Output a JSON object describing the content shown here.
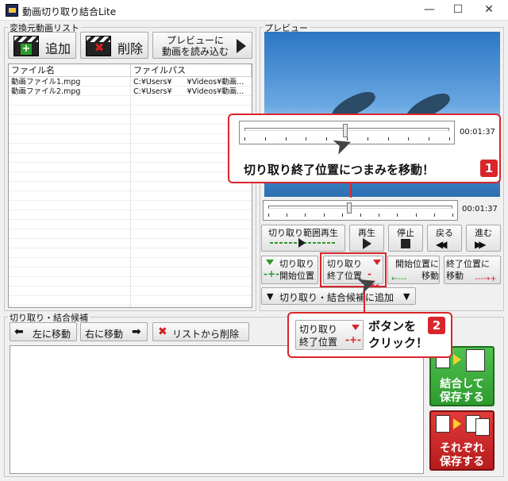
{
  "window": {
    "title": "動画切り取り結合Lite",
    "minimize": "—",
    "maximize": "☐",
    "close": "✕"
  },
  "source_list": {
    "group_label": "変換元動画リスト",
    "add_label": "追加",
    "delete_label": "削除",
    "load_preview_label": [
      "プレビューに",
      "動画を読み込む"
    ],
    "columns": [
      "ファイル名",
      "ファイルパス"
    ],
    "rows": [
      {
        "name": "動画ファイル1.mpg",
        "path": "C:¥Users¥　　¥Videos¥動画..."
      },
      {
        "name": "動画ファイル2.mpg",
        "path": "C:¥Users¥　　¥Videos¥動画..."
      }
    ]
  },
  "preview": {
    "group_label": "プレビュー",
    "time": "00:01:37",
    "position_fraction": 0.44
  },
  "controls": {
    "range_play": "切り取り範囲再生",
    "play": "再生",
    "stop": "停止",
    "back": "戻る",
    "forward": "進む",
    "cut_start": [
      "切り取り",
      "開始位置"
    ],
    "cut_end": [
      "切り取り",
      "終了位置"
    ],
    "move_to_start": [
      "開始位置に",
      "移動"
    ],
    "move_to_end": [
      "終了位置に",
      "移動"
    ],
    "add_to_candidates": "切り取り・結合候補に追加"
  },
  "candidates": {
    "group_label": "切り取り・結合候補",
    "move_left": "左に移動",
    "move_right": "右に移動",
    "remove": "リストから削除",
    "join_save": [
      "結合して",
      "保存する"
    ],
    "save_each": [
      "それぞれ",
      "保存する"
    ]
  },
  "annotations": {
    "callout1_text": "切り取り終了位置につまみを移動！",
    "callout1_num": "1",
    "callout2_button": [
      "切り取り",
      "終了位置"
    ],
    "callout2_text": [
      "ボタンを",
      "クリック！"
    ],
    "callout2_num": "2",
    "zoom_time": "00:01:37"
  },
  "colors": {
    "accent_red": "#d9252b",
    "green": "#2e9a2e",
    "save_red": "#b51c1c",
    "video_blue": "#2c77c4"
  }
}
